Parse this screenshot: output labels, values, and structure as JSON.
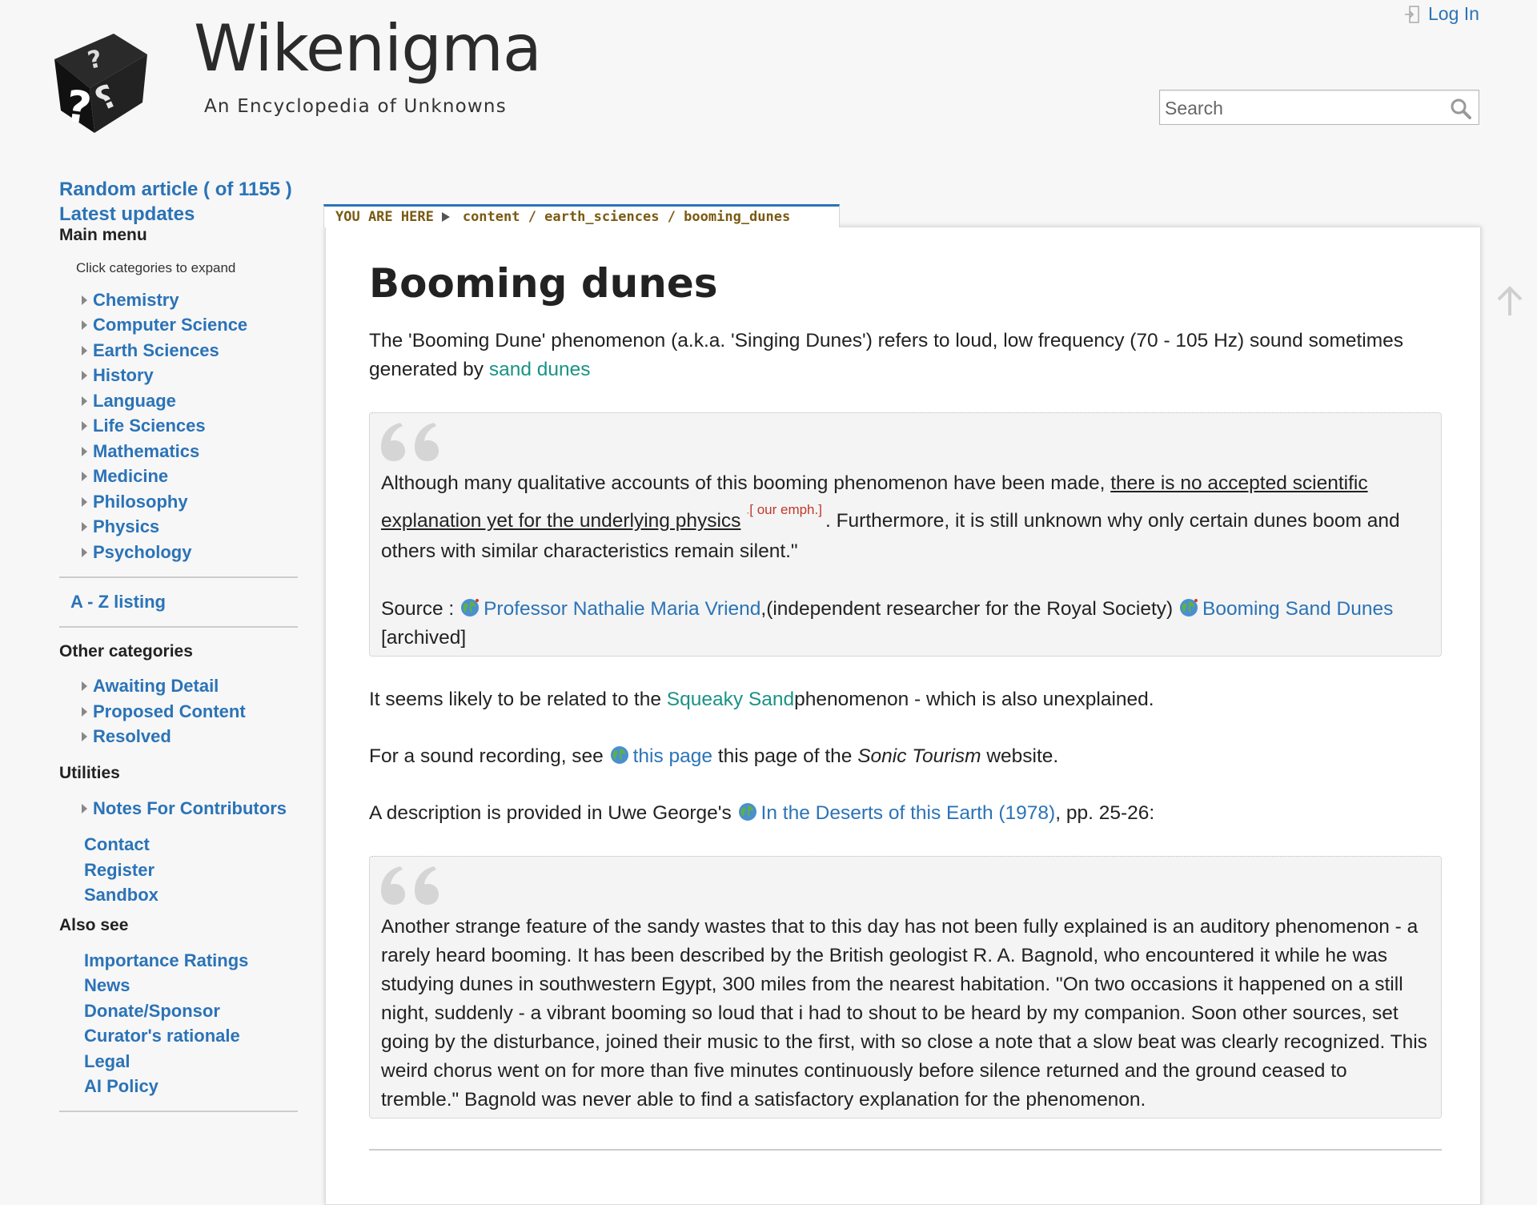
{
  "header": {
    "site_title": "Wikenigma",
    "tagline": "An Encyclopedia of Unknowns",
    "login_label": "Log In",
    "search_placeholder": "Search"
  },
  "sidebar": {
    "random_article": "Random article ( of 1155 )",
    "latest_updates": "Latest updates",
    "main_menu_heading": "Main menu",
    "hint": "Click categories to expand",
    "categories": [
      "Chemistry",
      "Computer Science",
      "Earth Sciences",
      "History",
      "Language",
      "Life Sciences",
      "Mathematics",
      "Medicine",
      "Philosophy",
      "Physics",
      "Psychology"
    ],
    "az_listing": "A - Z listing",
    "other_heading": "Other categories",
    "other_categories": [
      "Awaiting Detail",
      "Proposed Content",
      "Resolved"
    ],
    "utilities_heading": "Utilities",
    "utilities_tree": [
      "Notes For Contributors"
    ],
    "utilities_links": [
      "Contact",
      "Register",
      "Sandbox"
    ],
    "also_see_heading": "Also see",
    "also_see_links": [
      "Importance Ratings",
      "News",
      "Donate/Sponsor",
      "Curator's rationale",
      "Legal",
      "AI Policy"
    ]
  },
  "breadcrumb": {
    "label": "YOU ARE HERE",
    "path": "content / earth_sciences / booming_dunes"
  },
  "article": {
    "title": "Booming dunes",
    "intro_text": "The 'Booming Dune' phenomenon (a.k.a. 'Singing Dunes') refers to loud, low frequency (70 - 105 Hz) sound sometimes generated by ",
    "intro_link": "sand dunes",
    "quote1": {
      "text_before": "Although many qualitative accounts of this booming phenomenon have been made, ",
      "underlined": "there is no accepted scientific explanation yet for the underlying physics",
      "emph_note": "[ our emph.]",
      "text_after": ". Furthermore, it is still unknown why only certain dunes boom and others with similar characteristics remain silent.\"",
      "source_label": "Source : ",
      "source_link1": "Professor Nathalie Maria Vriend",
      "source_mid": ",(independent researcher for the Royal Society) ",
      "source_link2": "Booming Sand Dunes",
      "source_suffix": " [archived]"
    },
    "para_squeaky_before": "It seems likely to be related to the ",
    "para_squeaky_link": "Squeaky Sand",
    "para_squeaky_after": "phenomenon - which is also unexplained.",
    "para_sound_before": "For a sound recording, see ",
    "para_sound_link": "this page",
    "para_sound_mid": " this page of the ",
    "para_sound_italic": "Sonic Tourism",
    "para_sound_after": " website.",
    "para_desc_before": "A description is provided in Uwe George's ",
    "para_desc_link": "In the Deserts of this Earth (1978)",
    "para_desc_after": ", pp. 25-26:",
    "quote2": "Another strange feature of the sandy wastes that to this day has not been fully explained is an auditory phenomenon - a rarely heard booming. It has been described by the British geologist R. A. Bagnold, who encountered it while he was studying dunes in southwestern Egypt, 300 miles from the nearest habitation. \"On two occasions it happened on a still night, suddenly - a vibrant booming so loud that i had to shout to be heard by my companion. Soon other sources, set going by the disturbance, joined their music to the first, with so close a note that a slow beat was clearly recognized. This weird chorus went on for more than five minutes continuously before silence returned and the ground ceased to tremble.\" Bagnold was never able to find a satisfactory explanation for the phenomenon."
  },
  "colors": {
    "link_blue": "#2b73b7",
    "link_teal": "#1a9385",
    "breadcrumb_text": "#7a5a12",
    "emph_red": "#c0392b"
  },
  "icons": {
    "logo": "question-mark-cube-icon",
    "login": "login-icon",
    "search": "magnifier-icon",
    "tree_expand": "triangle-right-icon",
    "external_link": "globe-icon",
    "quote": "quote-mark-icon",
    "scroll_top": "arrow-up-icon"
  }
}
